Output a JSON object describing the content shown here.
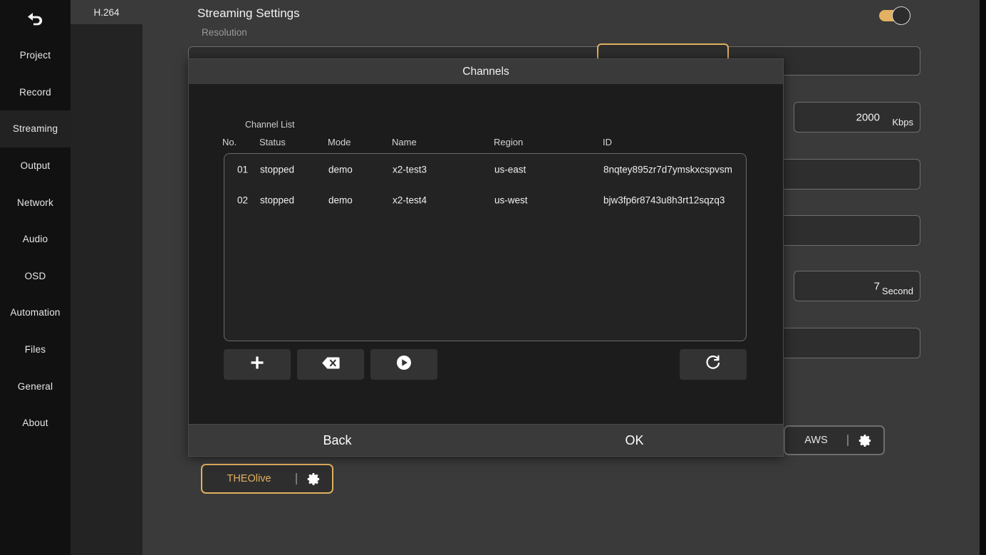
{
  "sidebar": {
    "back_icon": "back-arrow-icon",
    "items": [
      {
        "label": "Project",
        "active": false
      },
      {
        "label": "Record",
        "active": false
      },
      {
        "label": "Streaming",
        "active": true
      },
      {
        "label": "Output",
        "active": false
      },
      {
        "label": "Network",
        "active": false
      },
      {
        "label": "Audio",
        "active": false
      },
      {
        "label": "OSD",
        "active": false
      },
      {
        "label": "Automation",
        "active": false
      },
      {
        "label": "Files",
        "active": false
      },
      {
        "label": "General",
        "active": false
      },
      {
        "label": "About",
        "active": false
      }
    ]
  },
  "subpanel": {
    "codec_tab": "H.264"
  },
  "main": {
    "page_title": "Streaming Settings",
    "resolution_label": "Resolution",
    "toggle": {
      "name": "streaming-enable-toggle",
      "state": "on",
      "accent": "#e2b161"
    },
    "fields": [
      {
        "name": "bitrate-field",
        "value": "2000",
        "unit": "Kbps"
      },
      {
        "name": "gop-field",
        "value": "",
        "unit": ""
      },
      {
        "name": "profile-field",
        "value": "",
        "unit": ""
      },
      {
        "name": "keyframe-field",
        "value": "7",
        "unit": "Second"
      },
      {
        "name": "extra-field",
        "value": "",
        "unit": ""
      }
    ],
    "chips": [
      {
        "name": "aws-chip",
        "label": "AWS",
        "accent": false,
        "gear": "gear-icon"
      },
      {
        "name": "theolive-chip",
        "label": "THEOlive",
        "accent": true,
        "gear": "gear-icon"
      }
    ]
  },
  "dialog": {
    "title": "Channels",
    "list_label": "Channel List",
    "columns": [
      "No.",
      "Status",
      "Mode",
      "Name",
      "Region",
      "ID"
    ],
    "rows": [
      {
        "no": "01",
        "status": "stopped",
        "mode": "demo",
        "name": "x2-test3",
        "region": "us-east",
        "id": "8nqtey895zr7d7ymskxcspvsm"
      },
      {
        "no": "02",
        "status": "stopped",
        "mode": "demo",
        "name": "x2-test4",
        "region": "us-west",
        "id": "bjw3fp6r8743u8h3rt12sqzq3"
      }
    ],
    "toolbar": [
      {
        "name": "add-channel-button",
        "icon": "plus-icon"
      },
      {
        "name": "delete-channel-button",
        "icon": "backspace-delete-icon"
      },
      {
        "name": "start-channel-button",
        "icon": "play-icon"
      },
      {
        "name": "refresh-channels-button",
        "icon": "refresh-icon"
      }
    ],
    "footer": {
      "back_label": "Back",
      "ok_label": "OK"
    }
  }
}
